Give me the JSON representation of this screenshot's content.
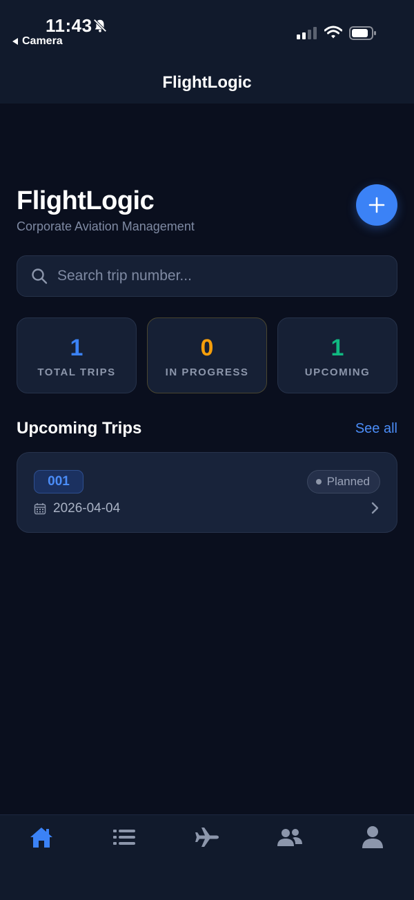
{
  "status_bar": {
    "time": "11:43",
    "back_app": "Camera"
  },
  "nav": {
    "title": "FlightLogic"
  },
  "header": {
    "title": "FlightLogic",
    "subtitle": "Corporate Aviation Management",
    "add_button_icon": "plus-icon"
  },
  "search": {
    "placeholder": "Search trip number...",
    "value": ""
  },
  "stats": [
    {
      "value": "1",
      "label": "TOTAL TRIPS",
      "color": "#3b82f6"
    },
    {
      "value": "0",
      "label": "IN PROGRESS",
      "color": "#f59e0b"
    },
    {
      "value": "1",
      "label": "UPCOMING",
      "color": "#10b981"
    }
  ],
  "upcoming": {
    "title": "Upcoming Trips",
    "see_all": "See all",
    "trips": [
      {
        "number": "001",
        "status": "Planned",
        "date": "2026-04-04"
      }
    ]
  },
  "tab_bar": {
    "active_color": "#3b82f6",
    "items": [
      {
        "icon": "home-icon",
        "active": true
      },
      {
        "icon": "list-icon",
        "active": false
      },
      {
        "icon": "airplane-icon",
        "active": false
      },
      {
        "icon": "users-icon",
        "active": false
      },
      {
        "icon": "profile-icon",
        "active": false
      }
    ]
  }
}
